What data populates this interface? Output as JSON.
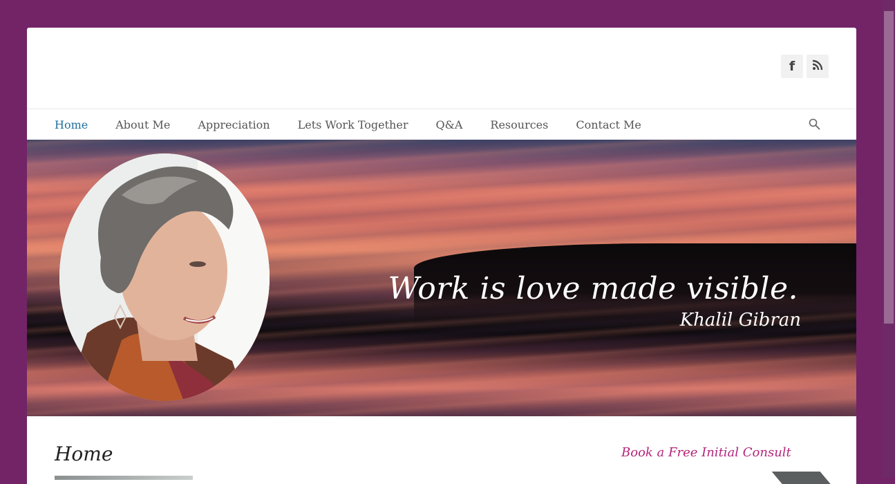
{
  "header": {
    "social": [
      {
        "name": "facebook-icon",
        "glyph": "f"
      },
      {
        "name": "rss-icon"
      }
    ]
  },
  "nav": {
    "items": [
      {
        "label": "Home",
        "active": true
      },
      {
        "label": "About Me"
      },
      {
        "label": "Appreciation"
      },
      {
        "label": "Lets Work Together"
      },
      {
        "label": "Q&A"
      },
      {
        "label": "Resources"
      },
      {
        "label": "Contact Me"
      }
    ],
    "search_icon": "search-icon"
  },
  "banner": {
    "quote": "Work is love made visible.",
    "author": "Khalil Gibran"
  },
  "content": {
    "heading": "Home",
    "sidebar_link": "Book a Free Initial Consult"
  },
  "colors": {
    "background": "#722467",
    "nav_active": "#1e6f9f",
    "nav_text": "#555555",
    "accent_link": "#b3247a"
  }
}
